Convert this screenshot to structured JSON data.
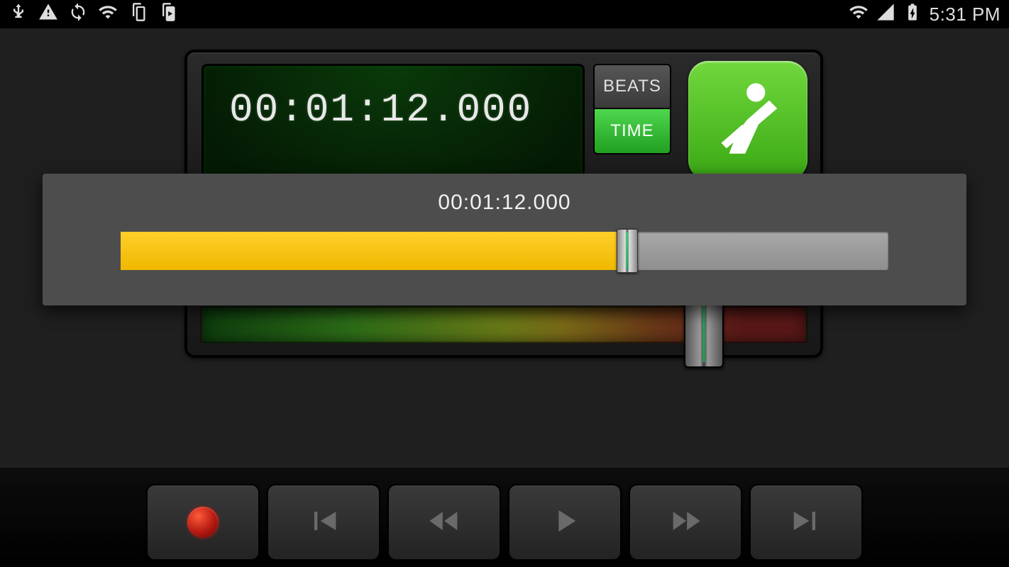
{
  "status": {
    "time": "5:31 PM"
  },
  "display": {
    "timecode": "00:01:12.000"
  },
  "toggle": {
    "beats": "BEATS",
    "time": "TIME"
  },
  "overlay": {
    "time": "00:01:12.000",
    "progress_percent": 66
  },
  "colors": {
    "accent_green": "#4fd64f",
    "progress_yellow": "#ffcf2a"
  }
}
